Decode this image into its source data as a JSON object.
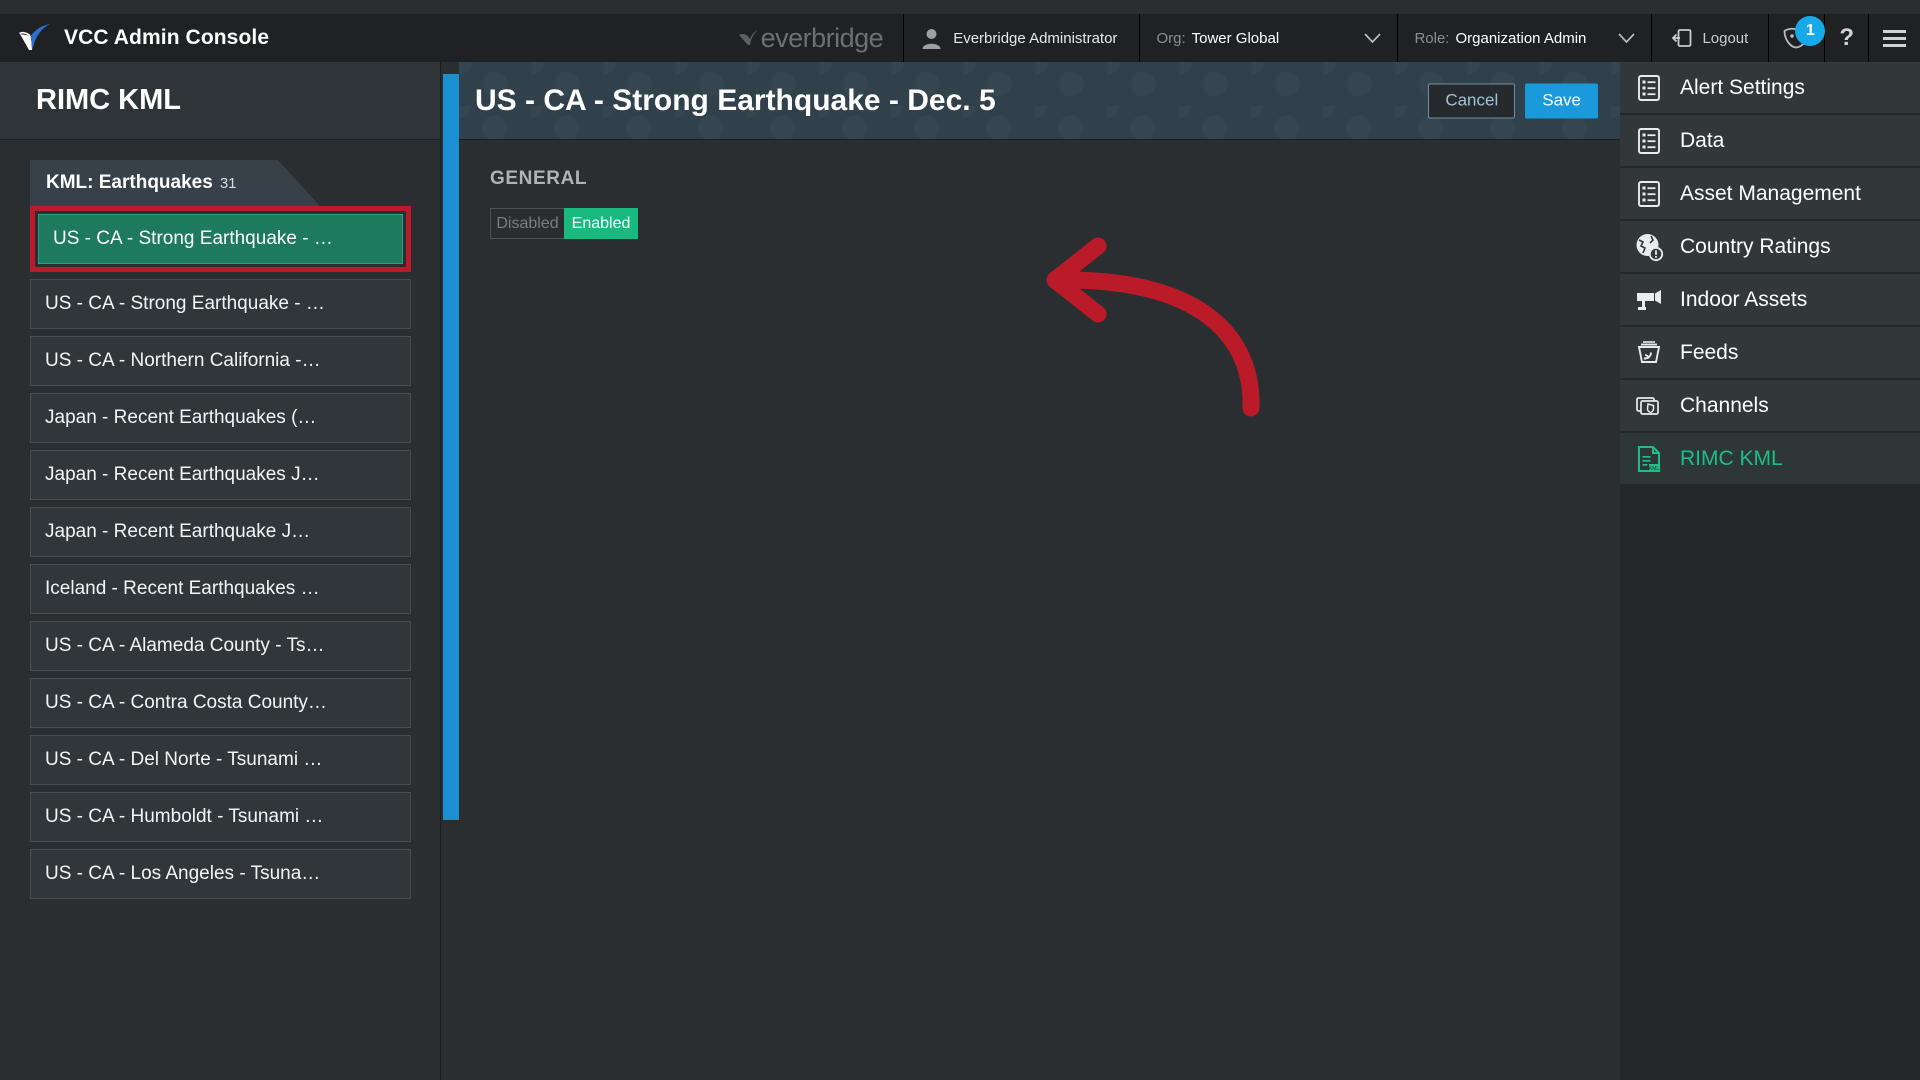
{
  "topbar": {
    "brand": "VCC Admin Console",
    "brand_logo_icon": "everbridge-checkmark-logo",
    "everbridge_wordmark": "everbridge",
    "user_icon": "user-avatar-icon",
    "user_name": "Everbridge Administrator",
    "org_label": "Org:",
    "org_value": "Tower Global",
    "org_chevron_icon": "chevron-down-icon",
    "role_label": "Role:",
    "role_value": "Organization Admin",
    "role_chevron_icon": "chevron-down-icon",
    "logout_icon": "logout-arrow-icon",
    "logout_label": "Logout",
    "notification_icon": "mask-notification-icon",
    "notification_count": "1",
    "help_icon": "question-mark-icon",
    "help_label": "?",
    "menu_icon": "hamburger-menu-icon"
  },
  "left_panel": {
    "title": "RIMC KML",
    "tab": {
      "label": "KML: Earthquakes",
      "count": "31"
    },
    "items": [
      {
        "label": "US - CA - Strong Earthquake - …",
        "selected": true,
        "highlighted": true
      },
      {
        "label": "US - CA - Strong Earthquake - …",
        "selected": false,
        "highlighted": false
      },
      {
        "label": "US - CA - Northern California -…",
        "selected": false,
        "highlighted": false
      },
      {
        "label": "Japan - Recent Earthquakes (…",
        "selected": false,
        "highlighted": false
      },
      {
        "label": "Japan - Recent Earthquakes J…",
        "selected": false,
        "highlighted": false
      },
      {
        "label": "Japan - Recent Earthquake J…",
        "selected": false,
        "highlighted": false
      },
      {
        "label": "Iceland - Recent Earthquakes …",
        "selected": false,
        "highlighted": false
      },
      {
        "label": "US - CA - Alameda County - Ts…",
        "selected": false,
        "highlighted": false
      },
      {
        "label": "US - CA - Contra Costa County…",
        "selected": false,
        "highlighted": false
      },
      {
        "label": "US - CA - Del Norte - Tsunami …",
        "selected": false,
        "highlighted": false
      },
      {
        "label": "US - CA - Humboldt - Tsunami …",
        "selected": false,
        "highlighted": false
      },
      {
        "label": "US - CA - Los Angeles - Tsuna…",
        "selected": false,
        "highlighted": false
      }
    ]
  },
  "main": {
    "title": "US - CA - Strong Earthquake - Dec. 5",
    "cancel_label": "Cancel",
    "save_label": "Save",
    "section_label": "GENERAL",
    "toggle": {
      "disabled_label": "Disabled",
      "enabled_label": "Enabled",
      "selected": "Enabled"
    },
    "annotation_icon": "red-curved-arrow-annotation"
  },
  "right_menu": {
    "items": [
      {
        "label": "Alert Settings",
        "icon": "list-document-icon",
        "active": false
      },
      {
        "label": "Data",
        "icon": "list-document-icon",
        "active": false
      },
      {
        "label": "Asset Management",
        "icon": "list-document-icon",
        "active": false
      },
      {
        "label": "Country Ratings",
        "icon": "globe-alert-icon",
        "active": false
      },
      {
        "label": "Indoor Assets",
        "icon": "security-camera-icon",
        "active": false
      },
      {
        "label": "Feeds",
        "icon": "rss-feed-box-icon",
        "active": false
      },
      {
        "label": "Channels",
        "icon": "channels-stack-icon",
        "active": false
      },
      {
        "label": "RIMC KML",
        "icon": "kml-file-icon",
        "active": true
      }
    ]
  },
  "colors": {
    "accent_blue": "#1a9ada",
    "accent_green": "#18bb7f",
    "selected_green": "#1e7a5c",
    "annotation_red": "#bb1b29",
    "badge_blue": "#18a9e8",
    "panel_bg": "#2a2e30",
    "header_bg": "#30414b"
  }
}
